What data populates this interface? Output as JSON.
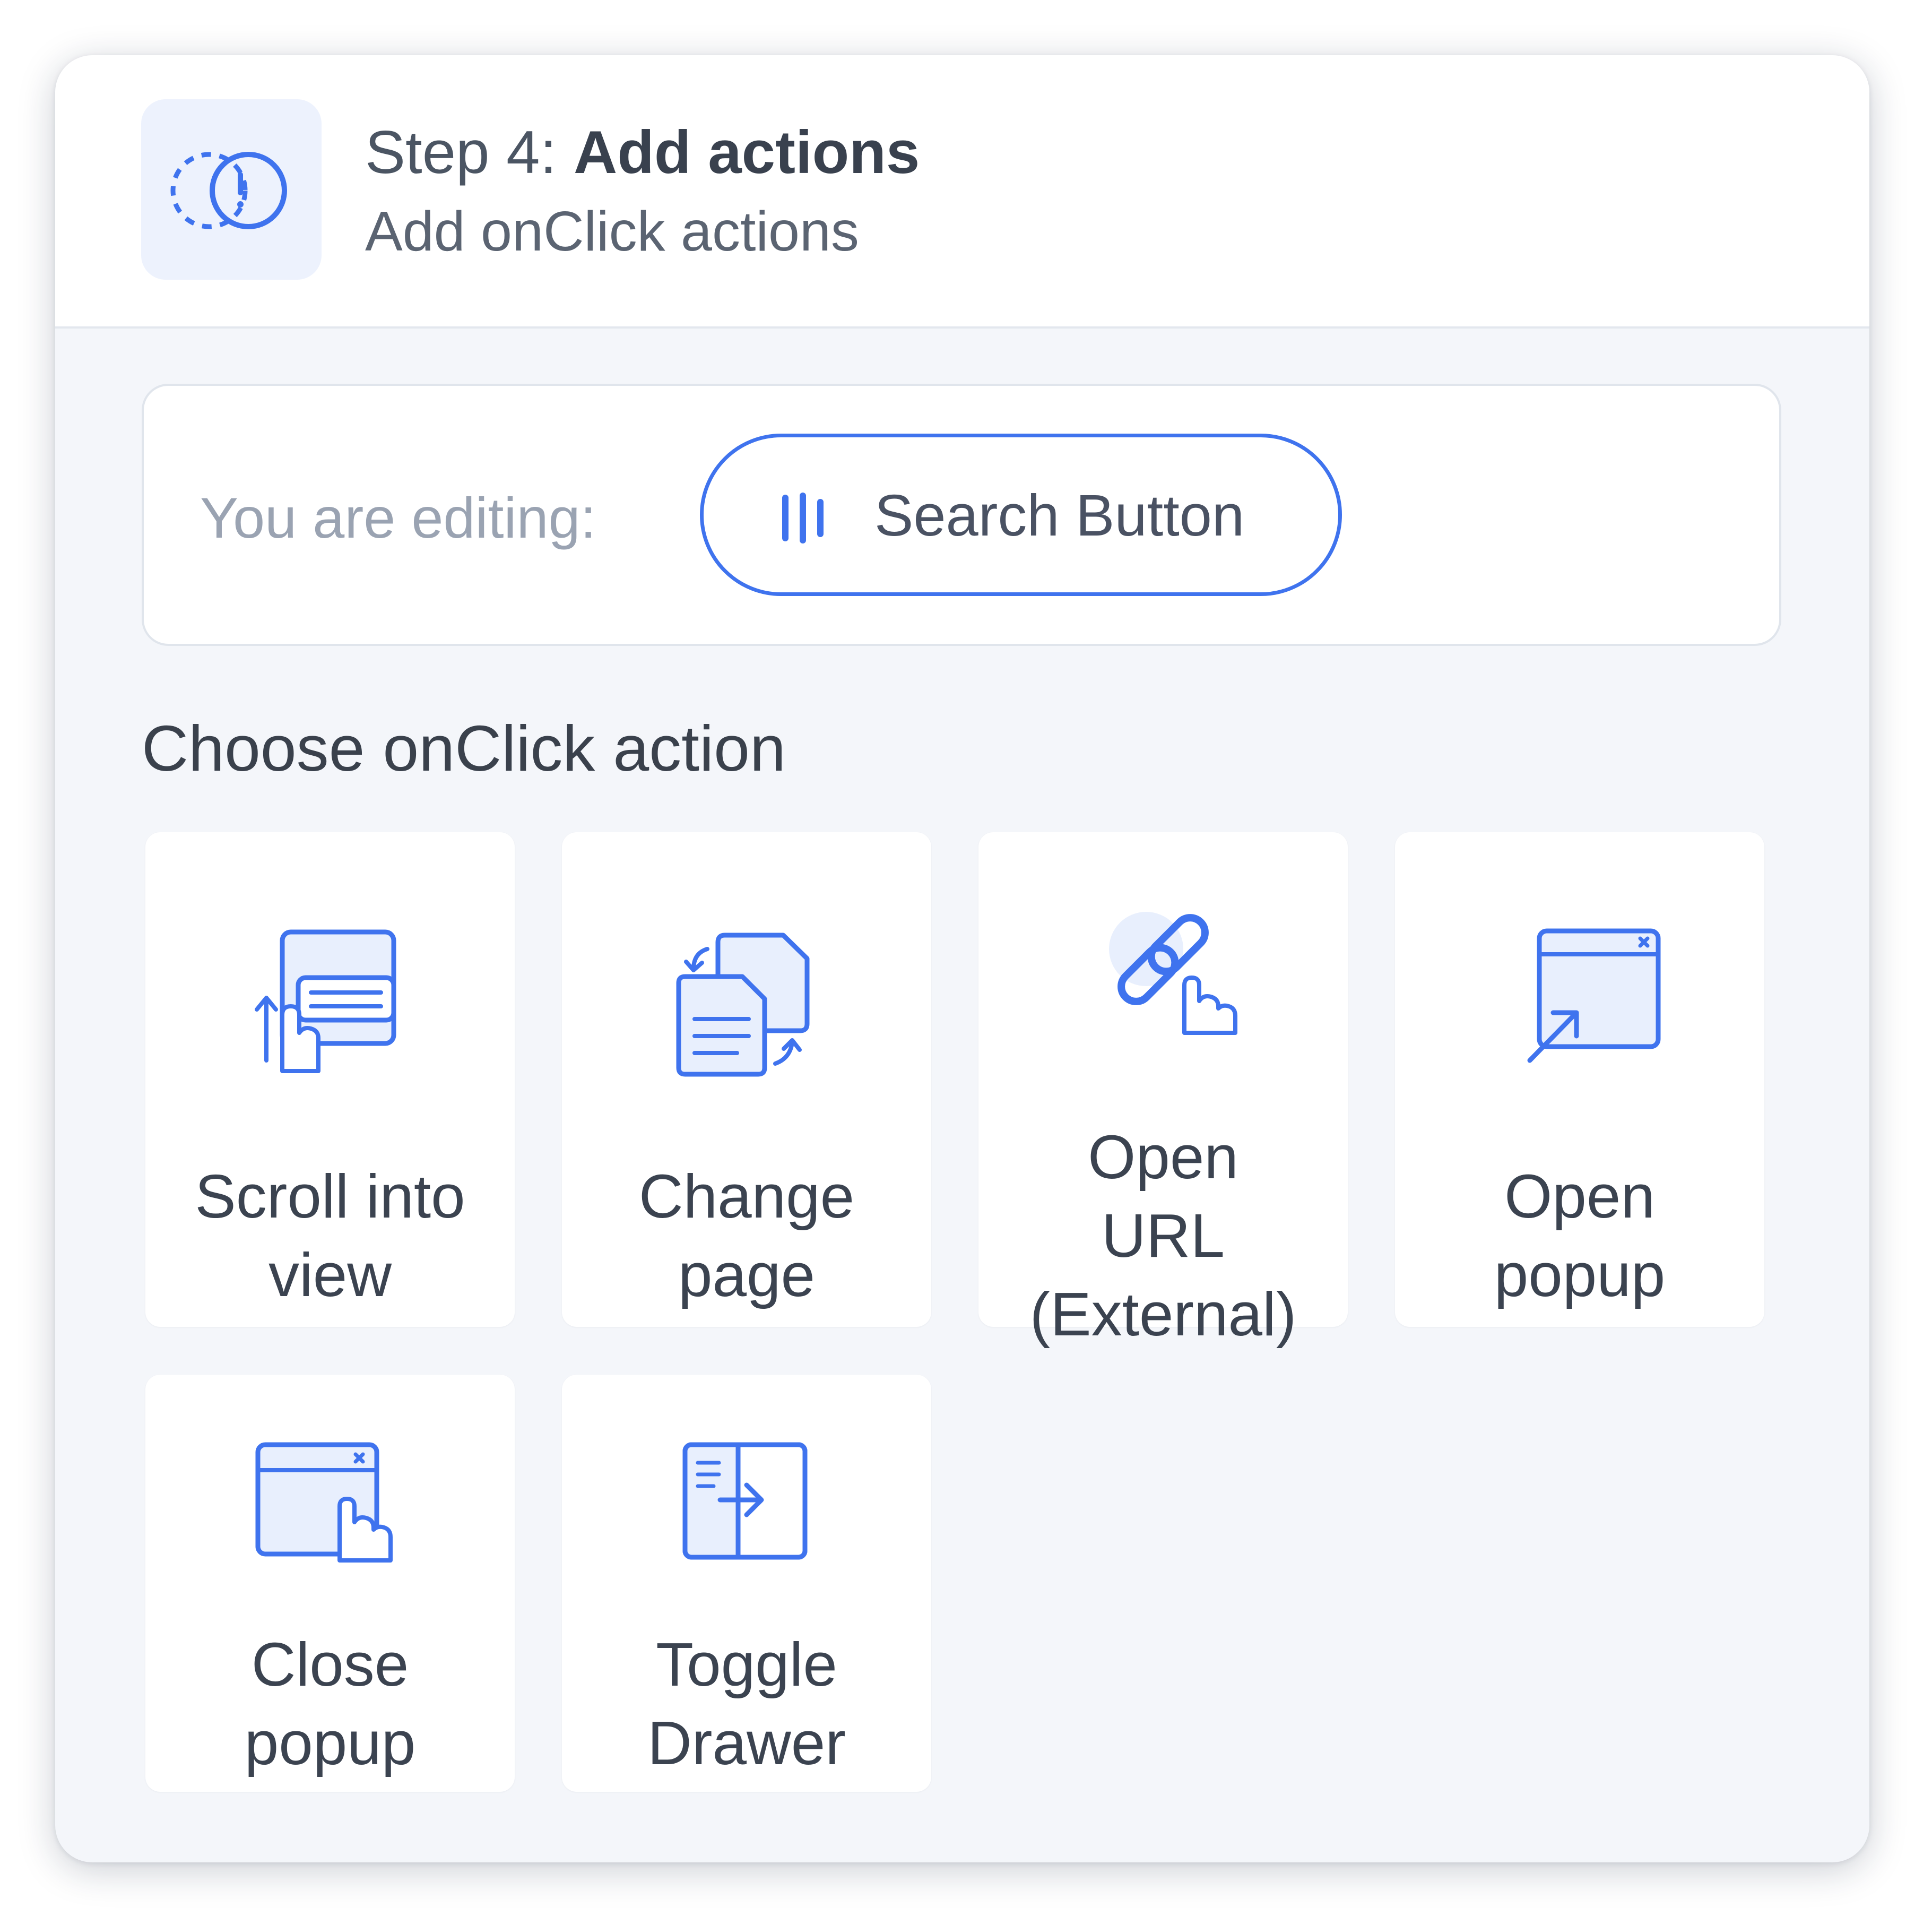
{
  "header": {
    "icon": "dashed-circles-icon",
    "step_prefix": "Step 4:",
    "step_title": "Add actions",
    "subtitle": "Add onClick actions"
  },
  "editing": {
    "label": "You are editing:",
    "element_icon": "bars-icon",
    "element_name": "Search Button"
  },
  "section_title": "Choose onClick action",
  "actions": [
    {
      "line1": "Scroll into",
      "line2": "view",
      "icon": "scroll-into-view-icon"
    },
    {
      "line1": "Change",
      "line2": "page",
      "icon": "change-page-icon"
    },
    {
      "line1": "Open",
      "line2": "URL",
      "line3": "(External)",
      "icon": "link-click-icon"
    },
    {
      "line1": "Open",
      "line2": "popup",
      "icon": "open-popup-icon"
    },
    {
      "line1": "Close",
      "line2": "popup",
      "icon": "close-popup-icon"
    },
    {
      "line1": "Toggle",
      "line2": "Drawer",
      "icon": "toggle-drawer-icon"
    }
  ],
  "colors": {
    "accent": "#3f73ee",
    "icon_fill": "#e8effd",
    "panel_bg": "#f4f6fa",
    "text": "#3b4350"
  }
}
